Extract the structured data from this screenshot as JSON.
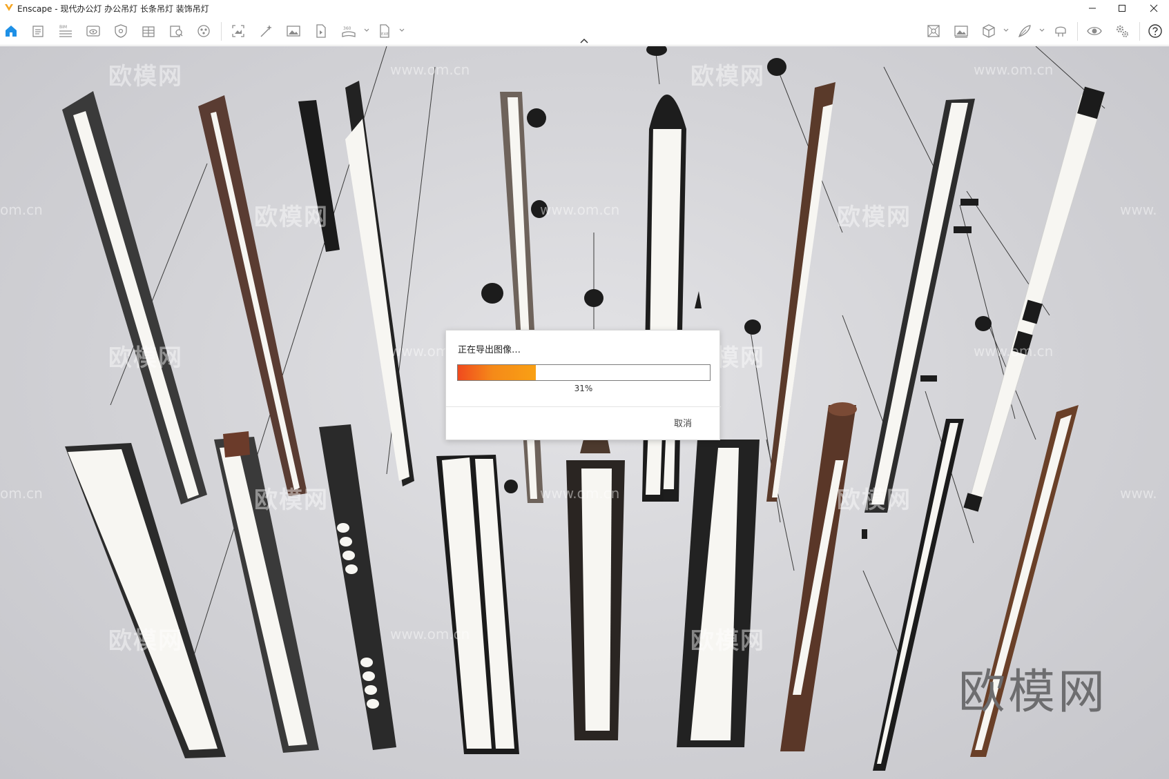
{
  "window": {
    "title": "Enscape - 现代办公灯 办公吊灯 长条吊灯 装饰吊灯"
  },
  "toolbar": {
    "left_icons": [
      "home-icon",
      "document-icon",
      "bim-icon",
      "view-icon",
      "safe-frame-icon",
      "building-icon",
      "asset-library-icon",
      "material-icon",
      "screenshot-icon",
      "magic-wand-icon",
      "image-icon",
      "video-icon",
      "panorama-360-icon",
      "export-exe-icon"
    ],
    "right_icons": [
      "orthographic-icon",
      "image-gallery-icon",
      "cube-view-icon",
      "pen-sketch-icon",
      "vr-headset-icon",
      "visibility-icon",
      "settings-icon",
      "help-icon"
    ],
    "bim_text": "BIM",
    "pano_text": "360",
    "exe_text": "EXE"
  },
  "watermarks": {
    "logo_text": "欧模网",
    "url_text": "www.om.cn",
    "partial_url_left": "om.cn",
    "partial_url_right": "www."
  },
  "export_dialog": {
    "title": "正在导出图像…",
    "progress_percent": 31,
    "progress_label": "31%",
    "cancel_label": "取消"
  },
  "colors": {
    "accent": "#f58a19",
    "accent_start": "#f04a1e",
    "home_icon": "#1e90e6",
    "logo": "#f5a623"
  }
}
